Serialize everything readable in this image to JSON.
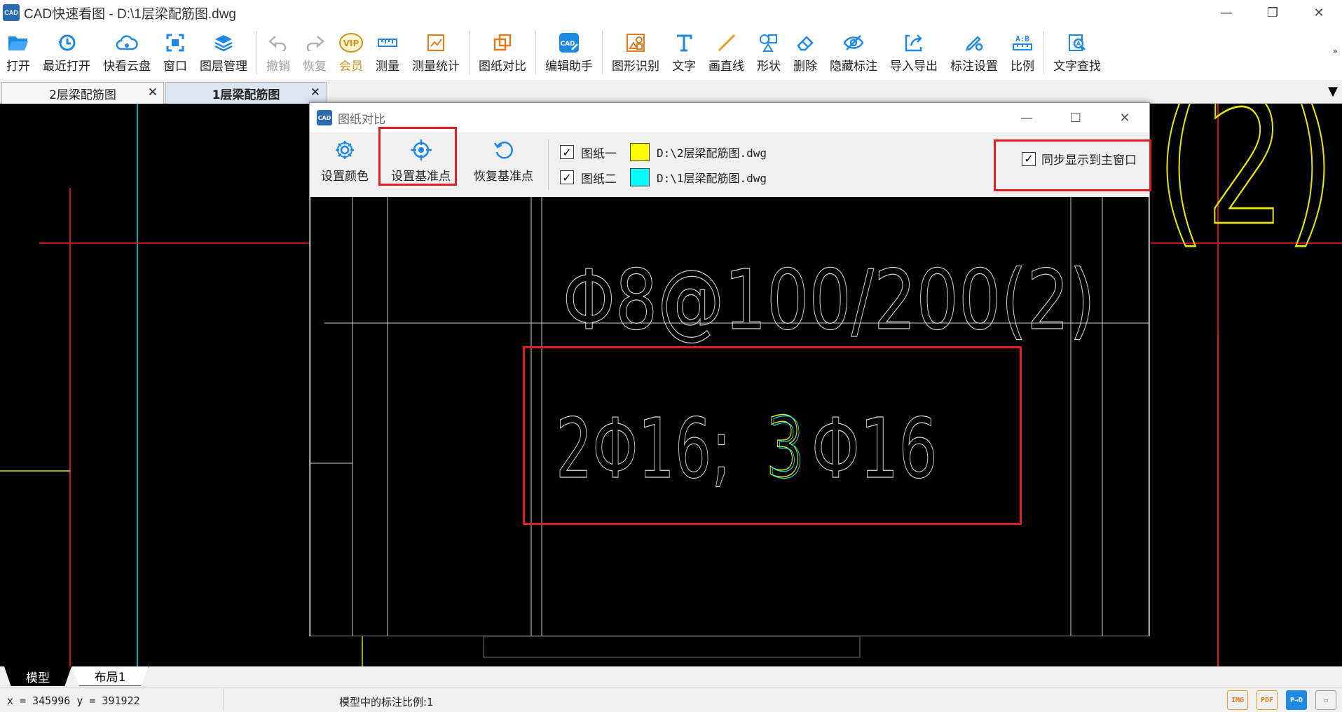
{
  "window": {
    "title": "CAD快速看图 - D:\\1层梁配筋图.dwg",
    "app_icon_text": "CAD",
    "controls": [
      "—",
      "❐",
      "✕"
    ]
  },
  "toolbar": {
    "items": [
      {
        "label": "打开",
        "icon": "folder-open-icon",
        "color": "#1e88e5"
      },
      {
        "label": "最近打开",
        "icon": "recent-clock-icon",
        "color": "#1e88e5"
      },
      {
        "label": "快看云盘",
        "icon": "cloud-icon",
        "color": "#1e88e5"
      },
      {
        "label": "窗口",
        "icon": "window-icon",
        "color": "#1e88e5"
      },
      {
        "label": "图层管理",
        "icon": "layers-icon",
        "color": "#1e88e5"
      },
      {
        "label": "撤销",
        "icon": "undo-icon",
        "color": "#b0b0b0",
        "disabled": true
      },
      {
        "label": "恢复",
        "icon": "redo-icon",
        "color": "#b0b0b0",
        "disabled": true
      },
      {
        "label": "会员",
        "icon": "vip-icon",
        "color": "#c8961e"
      },
      {
        "label": "测量",
        "icon": "ruler-icon",
        "color": "#1e88e5"
      },
      {
        "label": "测量统计",
        "icon": "measure-stats-icon",
        "color": "#e07b1e"
      },
      {
        "label": "图纸对比",
        "icon": "compare-icon",
        "color": "#e07b1e"
      },
      {
        "label": "编辑助手",
        "icon": "edit-assistant-icon",
        "color": "#1e88e5"
      },
      {
        "label": "图形识别",
        "icon": "shape-recognize-icon",
        "color": "#e07b1e"
      },
      {
        "label": "文字",
        "icon": "text-icon",
        "color": "#1e88e5"
      },
      {
        "label": "画直线",
        "icon": "line-icon",
        "color": "#e0a01e"
      },
      {
        "label": "形状",
        "icon": "shapes-icon",
        "color": "#1e88e5"
      },
      {
        "label": "删除",
        "icon": "eraser-icon",
        "color": "#1e88e5"
      },
      {
        "label": "隐藏标注",
        "icon": "hide-eye-icon",
        "color": "#1e88e5"
      },
      {
        "label": "导入导出",
        "icon": "import-export-icon",
        "color": "#1e88e5"
      },
      {
        "label": "标注设置",
        "icon": "annotation-settings-icon",
        "color": "#1e88e5"
      },
      {
        "label": "比例",
        "icon": "scale-ab-icon",
        "color": "#1e88e5"
      },
      {
        "label": "文字查找",
        "icon": "text-search-icon",
        "color": "#1e88e5"
      }
    ],
    "more": "»"
  },
  "tabs": [
    {
      "label": "2层梁配筋图",
      "close": "✕",
      "active": false
    },
    {
      "label": "1层梁配筋图",
      "close": "✕",
      "active": true
    }
  ],
  "tab_dropdown": "▼",
  "dialog": {
    "title": "图纸对比",
    "controls": [
      "—",
      "☐",
      "✕"
    ],
    "buttons": [
      {
        "label": "设置颜色",
        "icon": "gear-icon"
      },
      {
        "label": "设置基准点",
        "icon": "crosshair-icon"
      },
      {
        "label": "恢复基准点",
        "icon": "restore-icon"
      }
    ],
    "drawings": [
      {
        "name": "图纸一",
        "checked": true,
        "color": "#ffff00",
        "path": "D:\\2层梁配筋图.dwg"
      },
      {
        "name": "图纸二",
        "checked": true,
        "color": "#00ffff",
        "path": "D:\\1层梁配筋图.dwg"
      }
    ],
    "sync": {
      "label": "同步显示到主窗口",
      "checked": true
    },
    "drawing_text": {
      "line1": "Φ8@100/200(2)",
      "line2_left": "2Φ16;",
      "line2_digit": "3",
      "line2_right": "Φ16"
    }
  },
  "canvas": {
    "background_text": "(2)"
  },
  "layout_tabs": [
    "模型",
    "布局1"
  ],
  "status": {
    "coords": "x = 345996 y = 391922",
    "scale_text": "模型中的标注比例:1",
    "icons": [
      "export-image-icon",
      "pdf-icon",
      "cad-to-pdf-icon",
      "screen-icon"
    ]
  },
  "colors": {
    "accent_blue": "#1e88e5",
    "highlight_red": "#e02020",
    "cad_yellow": "#ffff00",
    "cad_cyan": "#00ffff",
    "cad_red": "#ff0000"
  }
}
